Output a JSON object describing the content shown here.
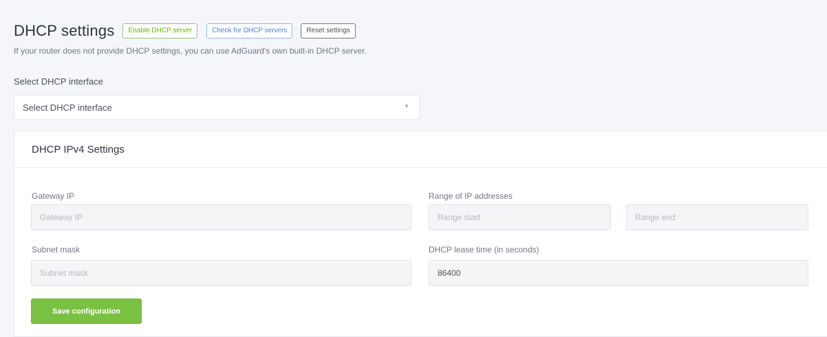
{
  "header": {
    "title": "DHCP settings",
    "enable_label": "Enable DHCP server",
    "check_label": "Check for DHCP servers",
    "reset_label": "Reset settings"
  },
  "subtitle": "If your router does not provide DHCP settings, you can use AdGuard's own built-in DHCP server.",
  "interface": {
    "label": "Select DHCP interface",
    "selected": "Select DHCP interface"
  },
  "ipv4": {
    "title": "DHCP IPv4 Settings",
    "gateway": {
      "label": "Gateway IP",
      "placeholder": "Gateway IP",
      "value": ""
    },
    "range": {
      "label": "Range of IP addresses",
      "start_placeholder": "Range start",
      "end_placeholder": "Range end"
    },
    "subnet": {
      "label": "Subnet mask",
      "placeholder": "Subnet mask",
      "value": ""
    },
    "lease": {
      "label": "DHCP lease time (in seconds)",
      "value": "86400"
    },
    "save_label": "Save configuration"
  },
  "colors": {
    "accent_green": "#7ac142",
    "accent_blue": "#467fcf",
    "background": "#f4f6fa"
  },
  "icons": {
    "select_arrow": "chevron-down-icon"
  }
}
